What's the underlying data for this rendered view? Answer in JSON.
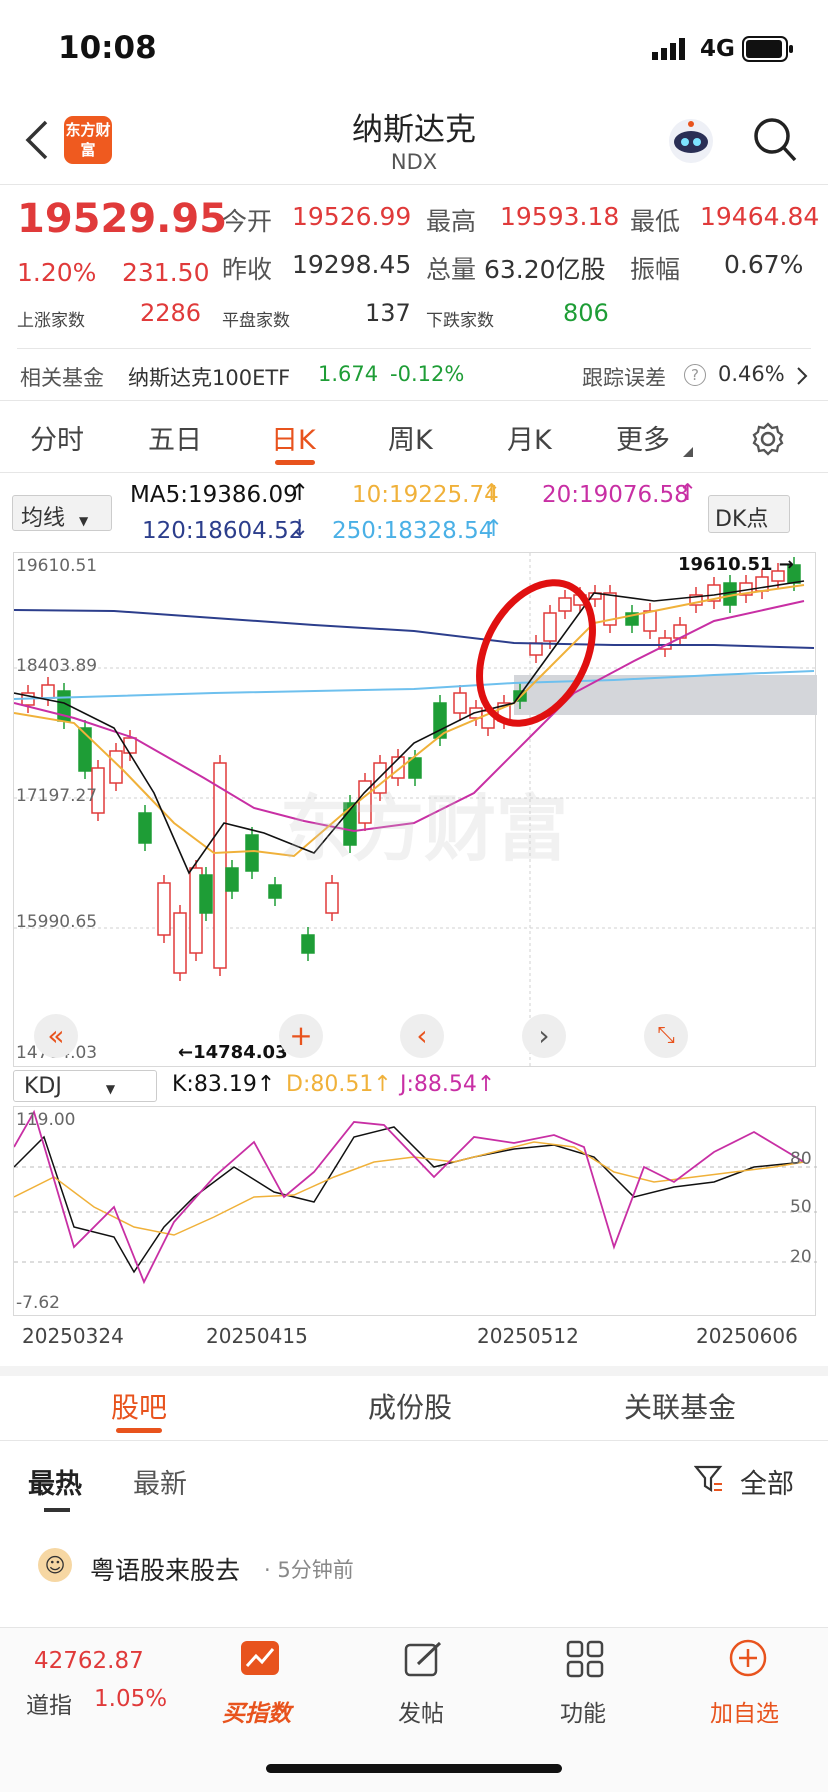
{
  "status": {
    "time": "10:08",
    "network": "4G"
  },
  "header": {
    "title": "纳斯达克",
    "code": "NDX",
    "logo_text": "东方财富"
  },
  "quote": {
    "price": "19529.95",
    "pct": "1.20%",
    "chg": "231.50",
    "open_label": "今开",
    "open": "19526.99",
    "high_label": "最高",
    "high": "19593.18",
    "low_label": "最低",
    "low": "19464.84",
    "prev_label": "昨收",
    "prev": "19298.45",
    "vol_label": "总量",
    "vol": "63.20亿股",
    "amp_label": "振幅",
    "amp": "0.67%",
    "up_label": "上涨家数",
    "up": "2286",
    "flat_label": "平盘家数",
    "flat": "137",
    "down_label": "下跌家数",
    "down": "806"
  },
  "fund": {
    "label": "相关基金",
    "name": "纳斯达克100ETF",
    "price": "1.674",
    "chg": "-0.12%",
    "err_label": "跟踪误差",
    "err": "0.46%"
  },
  "tabs": [
    "分时",
    "五日",
    "日K",
    "周K",
    "月K",
    "更多"
  ],
  "ma": {
    "select": "均线",
    "ma5": "MA5:19386.09",
    "ma10": "10:19225.74",
    "ma20": "20:19076.58",
    "ma120": "120:18604.52",
    "ma250": "250:18328.54",
    "dk": "DK点"
  },
  "price_axis": [
    "19610.51",
    "18403.89",
    "17197.27",
    "15990.65",
    "14784.03"
  ],
  "annotations": {
    "low": "14784.03",
    "high": "19610.51"
  },
  "kdj": {
    "select": "KDJ",
    "k": "K:83.19",
    "d": "D:80.51",
    "j": "J:88.54",
    "axis_top": "119.00",
    "axis_bottom": "-7.62",
    "lv80": "80",
    "lv50": "50",
    "lv20": "20"
  },
  "dates": [
    "20250324",
    "20250415",
    "20250512",
    "20250606"
  ],
  "section_tabs": [
    "股吧",
    "成份股",
    "关联基金"
  ],
  "sub_tabs": [
    "最热",
    "最新",
    "全部"
  ],
  "post": {
    "author": "粤语股来股去",
    "time": "5分钟前"
  },
  "bottom": {
    "dji_value": "42762.87",
    "dji_label": "道指",
    "dji_pct": "1.05%",
    "items": [
      "买指数",
      "发帖",
      "功能",
      "加自选"
    ]
  },
  "colors": {
    "up": "#e03a3a",
    "down": "#1e9d36",
    "accent": "#e8531d"
  }
}
